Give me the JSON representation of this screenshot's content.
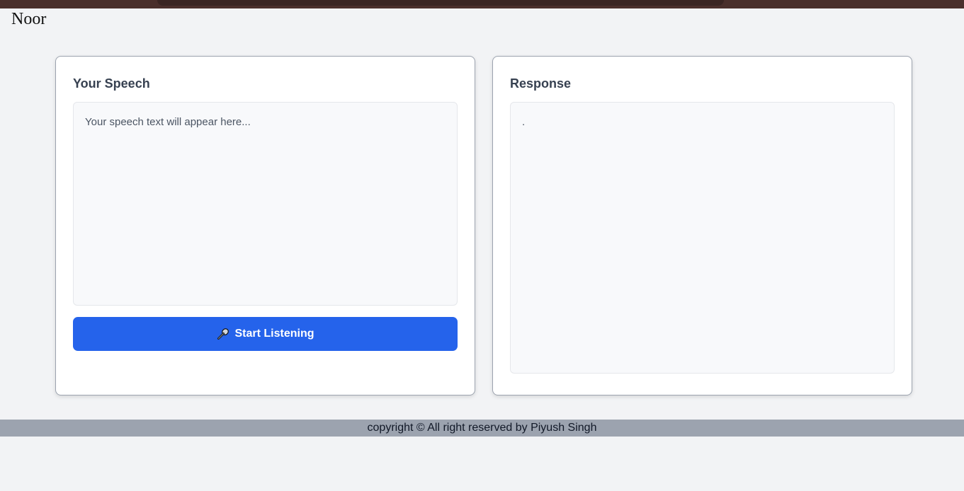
{
  "header": {
    "brand": "Noor"
  },
  "speech_panel": {
    "title": "Your Speech",
    "placeholder": "Your speech text will appear here...",
    "button_label": "Start Listening",
    "button_icon": "microphone-icon"
  },
  "response_panel": {
    "title": "Response",
    "content": "."
  },
  "footer": {
    "text": "copyright © All right reserved by Piyush Singh"
  },
  "colors": {
    "accent": "#2563eb",
    "page_background": "#f2f3f5",
    "footer_background": "#9ca3af"
  }
}
